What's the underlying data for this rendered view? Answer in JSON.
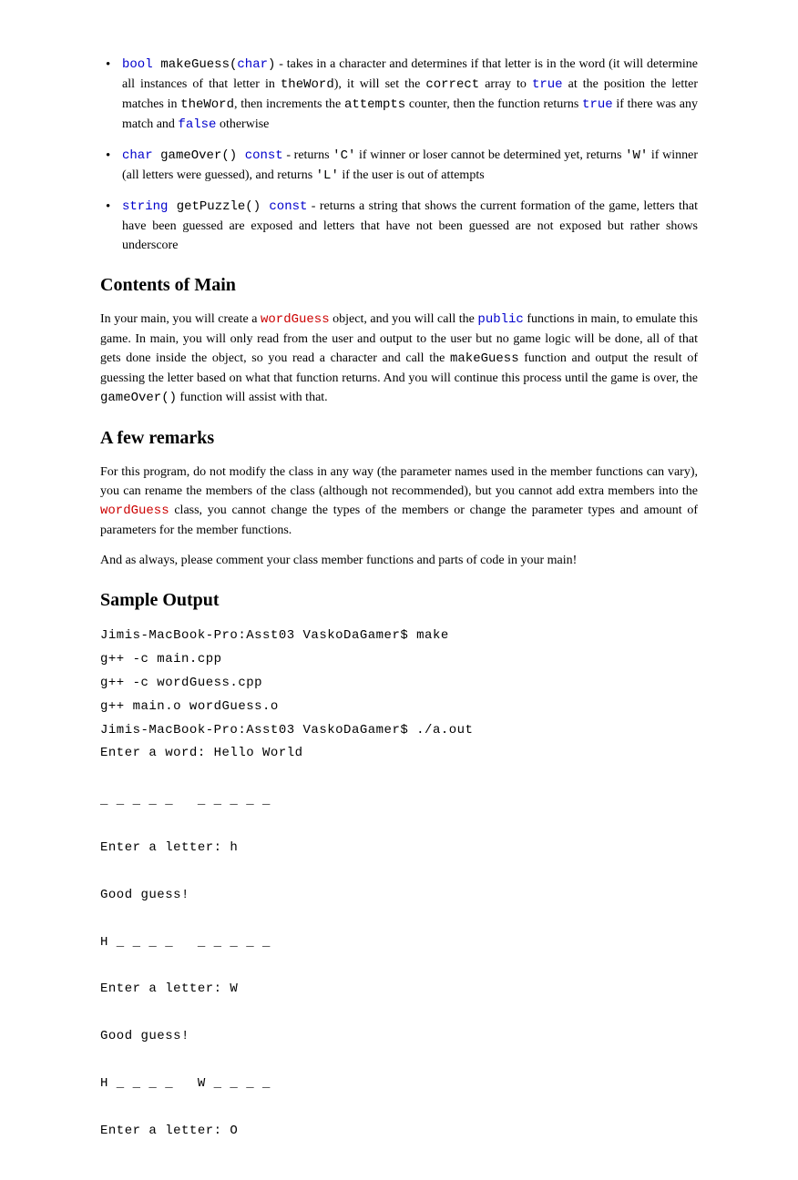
{
  "bullets": [
    {
      "sig_pre": "bool",
      "sig_name": " makeGuess(",
      "sig_arg": "char",
      "sig_post": ")",
      "desc_a": " - takes in a character and determines if that letter is in the word (it will determine all instances of that letter in ",
      "tt1": "theWord",
      "desc_b": "), it will set the ",
      "tt2": "correct",
      "desc_c": " array to ",
      "kw1": "true",
      "desc_d": " at the position the letter matches in ",
      "tt3": "theWord",
      "desc_e": ", then increments the ",
      "tt4": "attempts",
      "desc_f": " counter, then the function returns ",
      "kw2": "true",
      "desc_g": " if there was any match and ",
      "kw3": "false",
      "desc_h": " otherwise"
    },
    {
      "sig_pre": "char",
      "sig_name": " gameOver() ",
      "sig_const": "const",
      "desc_a": " - returns ",
      "tt1": "'C'",
      "desc_b": " if winner or loser cannot be determined yet, returns ",
      "tt2": "'W'",
      "desc_c": " if winner (all letters were guessed), and returns ",
      "tt3": "'L'",
      "desc_d": " if the user is out of attempts"
    },
    {
      "sig_pre": "string",
      "sig_name": " getPuzzle() ",
      "sig_const": "const",
      "desc_a": " - returns a string that shows the current formation of the game, letters that have been guessed are exposed and letters that have not been guessed are not exposed but rather shows underscore"
    }
  ],
  "headings": {
    "contents": "Contents of Main",
    "remarks": "A few remarks",
    "sample": "Sample Output"
  },
  "main_para": {
    "a": "In your main, you will create a ",
    "kw1": "wordGuess",
    "b": " object, and you will call the ",
    "kw2": "public",
    "c": " functions in main, to emulate this game. In main, you will only read from the user and output to the user but no game logic will be done, all of that gets done inside the object, so you read a character and call the ",
    "tt1": "makeGuess",
    "d": " function and output the result of guessing the letter based on what that function returns. And you will continue this process until the game is over, the ",
    "tt2": "gameOver()",
    "e": " function will assist with that."
  },
  "remarks_para1": {
    "a": "For this program, do not modify the class in any way (the parameter names used in the member functions can vary), you can rename the members of the class (although not recommended), but you cannot add extra members into the ",
    "kw1": "wordGuess",
    "b": " class, you cannot change the types of the members or change the parameter types and amount of parameters for the member functions."
  },
  "remarks_para2": "And as always, please comment your class member functions and parts of code in your main!",
  "sample_output": "Jimis-MacBook-Pro:Asst03 VaskoDaGamer$ make\ng++ -c main.cpp\ng++ -c wordGuess.cpp\ng++ main.o wordGuess.o\nJimis-MacBook-Pro:Asst03 VaskoDaGamer$ ./a.out\nEnter a word: Hello World\n\n_ _ _ _ _   _ _ _ _ _\n\nEnter a letter: h\n\nGood guess!\n\nH _ _ _ _   _ _ _ _ _\n\nEnter a letter: W\n\nGood guess!\n\nH _ _ _ _   W _ _ _ _\n\nEnter a letter: O"
}
